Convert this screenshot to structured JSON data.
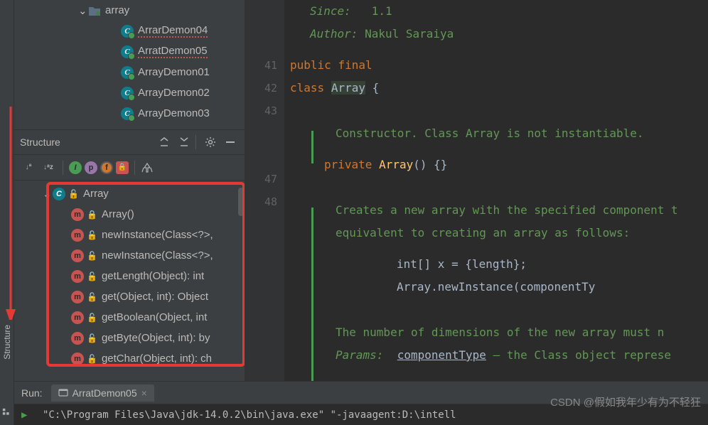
{
  "project": {
    "expanded_folder": "array",
    "files": [
      {
        "name": "ArrarDemon04",
        "squiggle": true
      },
      {
        "name": "ArratDemon05",
        "squiggle": true
      },
      {
        "name": "ArrayDemon01",
        "squiggle": false
      },
      {
        "name": "ArrayDemon02",
        "squiggle": false
      },
      {
        "name": "ArrayDemon03",
        "squiggle": false
      }
    ]
  },
  "structure": {
    "title": "Structure",
    "root": "Array",
    "members": [
      {
        "name": "Array()",
        "access": "private",
        "type": "constructor"
      },
      {
        "name": "newInstance(Class<?>,",
        "access": "public",
        "type": "method"
      },
      {
        "name": "newInstance(Class<?>,",
        "access": "public",
        "type": "method"
      },
      {
        "name": "getLength(Object): int",
        "access": "public",
        "type": "method"
      },
      {
        "name": "get(Object, int): Object",
        "access": "public",
        "type": "method"
      },
      {
        "name": "getBoolean(Object, int",
        "access": "public",
        "type": "method"
      },
      {
        "name": "getByte(Object, int): by",
        "access": "public",
        "type": "method"
      },
      {
        "name": "getChar(Object, int): ch",
        "access": "public",
        "type": "method"
      }
    ]
  },
  "editor": {
    "doc_top": {
      "since_label": "Since:",
      "since_value": "1.1",
      "author_label": "Author:",
      "author_value": "Nakul Saraiya"
    },
    "gutter": [
      "41",
      "42",
      "43",
      "",
      "",
      "47",
      "48"
    ],
    "code": {
      "l1": {
        "public": "public",
        "final": "final"
      },
      "l2": {
        "class": "class",
        "name": "Array",
        "brace": "{"
      },
      "doc1": "Constructor. Class Array is not instantiable.",
      "l3": {
        "private": "private",
        "name": "Array",
        "rest": "() {}"
      },
      "doc2a": "Creates a new array with the specified component t",
      "doc2b": "equivalent to creating an array as follows:",
      "code1": "int[] x = {length};",
      "code2": "Array.newInstance(componentTy",
      "doc3": "The number of dimensions of the new array must n",
      "params_label": "Params:",
      "params_name": "componentType",
      "params_rest": " – the Class object represe"
    }
  },
  "run": {
    "label": "Run:",
    "tab": "ArratDemon05",
    "console": "\"C:\\Program Files\\Java\\jdk-14.0.2\\bin\\java.exe\" \"-javaagent:D:\\intell"
  },
  "sidebar_tab": "Structure",
  "watermark": "CSDN @假如我年少有为不轻狂"
}
